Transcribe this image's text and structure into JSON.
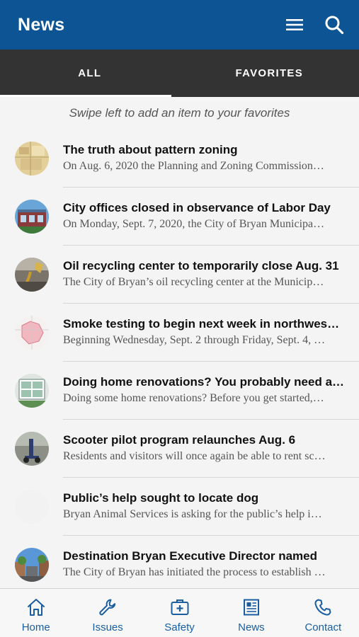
{
  "header": {
    "title": "News",
    "menu_icon": "hamburger-menu-icon",
    "search_icon": "search-icon",
    "background": "#0c5493"
  },
  "tabs": [
    {
      "label": "ALL",
      "active": true
    },
    {
      "label": "FAVORITES",
      "active": false
    }
  ],
  "hint": "Swipe left to add an item to your favorites",
  "news": [
    {
      "title": "The truth about pattern zoning",
      "summary": "On Aug. 6, 2020 the Planning and Zoning Commission…",
      "thumb": "zoning-map-thumbnail"
    },
    {
      "title": "City offices closed in observance of Labor Day",
      "summary": "On Monday, Sept. 7, 2020, the City of Bryan Municipa…",
      "thumb": "city-office-thumbnail"
    },
    {
      "title": "Oil recycling center to temporarily close Aug. 31",
      "summary": "The City of Bryan’s oil recycling center at the Municip…",
      "thumb": "oil-pour-thumbnail"
    },
    {
      "title": "Smoke testing to begin next week in northwes…",
      "summary": "Beginning Wednesday, Sept. 2 through Friday, Sept. 4, …",
      "thumb": "area-map-thumbnail"
    },
    {
      "title": "Doing home renovations? You probably need a…",
      "summary": "Doing some home renovations? Before you get started,…",
      "thumb": "house-window-thumbnail"
    },
    {
      "title": "Scooter pilot program relaunches Aug. 6",
      "summary": "Residents and visitors will once again be able to rent sc…",
      "thumb": "scooter-thumbnail"
    },
    {
      "title": "Public’s help sought to locate dog",
      "summary": "Bryan Animal Services is asking for the public’s help i…",
      "thumb": "blank-thumbnail"
    },
    {
      "title": "Destination Bryan Executive Director named",
      "summary": "The City of Bryan has initiated the process to establish …",
      "thumb": "downtown-thumbnail"
    }
  ],
  "bottom_nav": [
    {
      "label": "Home",
      "icon": "home-icon"
    },
    {
      "label": "Issues",
      "icon": "wrench-icon"
    },
    {
      "label": "Safety",
      "icon": "first-aid-icon"
    },
    {
      "label": "News",
      "icon": "newspaper-icon"
    },
    {
      "label": "Contact",
      "icon": "phone-icon"
    }
  ],
  "colors": {
    "accent": "#1a5ea0",
    "tab_bar": "#333333",
    "background": "#f4f4f4"
  }
}
